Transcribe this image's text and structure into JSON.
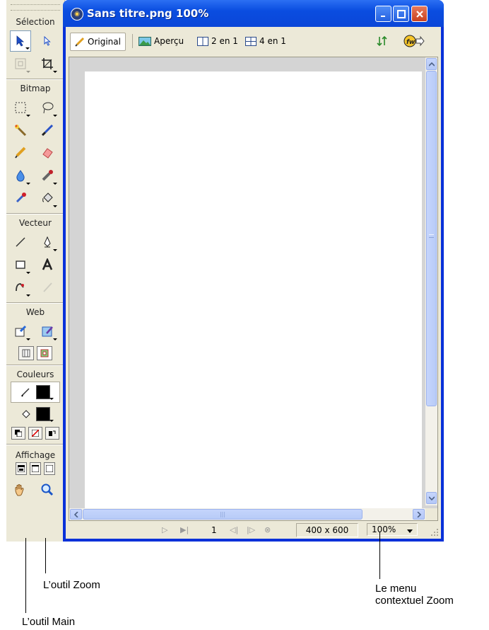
{
  "tools_panel": {
    "sections": {
      "selection": "Sélection",
      "bitmap": "Bitmap",
      "vector": "Vecteur",
      "web": "Web",
      "colors": "Couleurs",
      "view": "Affichage"
    }
  },
  "window": {
    "title": "Sans titre.png  100%",
    "toolbar": {
      "original": "Original",
      "preview": "Aperçu",
      "two_up": "2 en 1",
      "four_up": "4 en 1"
    },
    "statusbar": {
      "frame_number": "1",
      "dimensions": "400 x 600",
      "zoom": "100%"
    }
  },
  "callouts": {
    "zoom_tool": "L’outil Zoom",
    "hand_tool": "L’outil Main",
    "zoom_menu_line1": "Le menu",
    "zoom_menu_line2": "contextuel Zoom"
  }
}
